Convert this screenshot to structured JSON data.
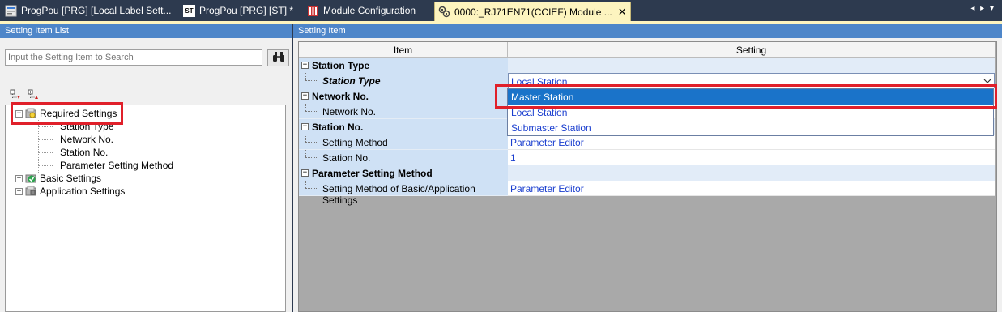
{
  "tabs": [
    {
      "label": "ProgPou [PRG] [Local Label Sett...",
      "icon": "program-icon",
      "active": false
    },
    {
      "label": "ProgPou [PRG] [ST] *",
      "icon": "st-icon",
      "icon_text": "ST",
      "active": false
    },
    {
      "label": "Module Configuration",
      "icon": "module-config-icon",
      "active": false
    },
    {
      "label": "0000:_RJ71EN71(CCIEF) Module ...",
      "icon": "module-param-icon",
      "active": true,
      "close": "✕"
    }
  ],
  "tab_nav": "◂ ▸ ▾",
  "left_pane": {
    "title": "Setting Item List",
    "search_placeholder": "Input the Setting Item to Search",
    "tree": {
      "required": {
        "label": "Required Settings",
        "expander": "−",
        "children": [
          "Station Type",
          "Network No.",
          "Station No.",
          "Parameter Setting Method"
        ]
      },
      "basic": {
        "label": "Basic Settings",
        "expander": "+"
      },
      "application": {
        "label": "Application Settings",
        "expander": "+"
      }
    }
  },
  "right_pane": {
    "title": "Setting Item",
    "columns": {
      "item": "Item",
      "setting": "Setting"
    },
    "rows": {
      "station_type": {
        "category": "Station Type",
        "item": "Station Type",
        "value": "Local Station"
      },
      "network_no": {
        "category": "Network No.",
        "item": "Network No."
      },
      "station_no": {
        "category": "Station No.",
        "setting_method_item": "Setting Method",
        "setting_method_value": "Parameter Editor",
        "station_no_item": "Station No.",
        "station_no_value": "1"
      },
      "param_method": {
        "category": "Parameter Setting Method",
        "item": "Setting Method of Basic/Application Settings",
        "value": "Parameter Editor"
      }
    },
    "dropdown_options": [
      "Master Station",
      "Local Station",
      "Submaster Station"
    ],
    "dropdown_selected": "Master Station"
  },
  "colors": {
    "accent": "#4e86c9",
    "highlight": "#e0202a",
    "selection": "#1a73c9",
    "value_text": "#1a3ecf"
  }
}
